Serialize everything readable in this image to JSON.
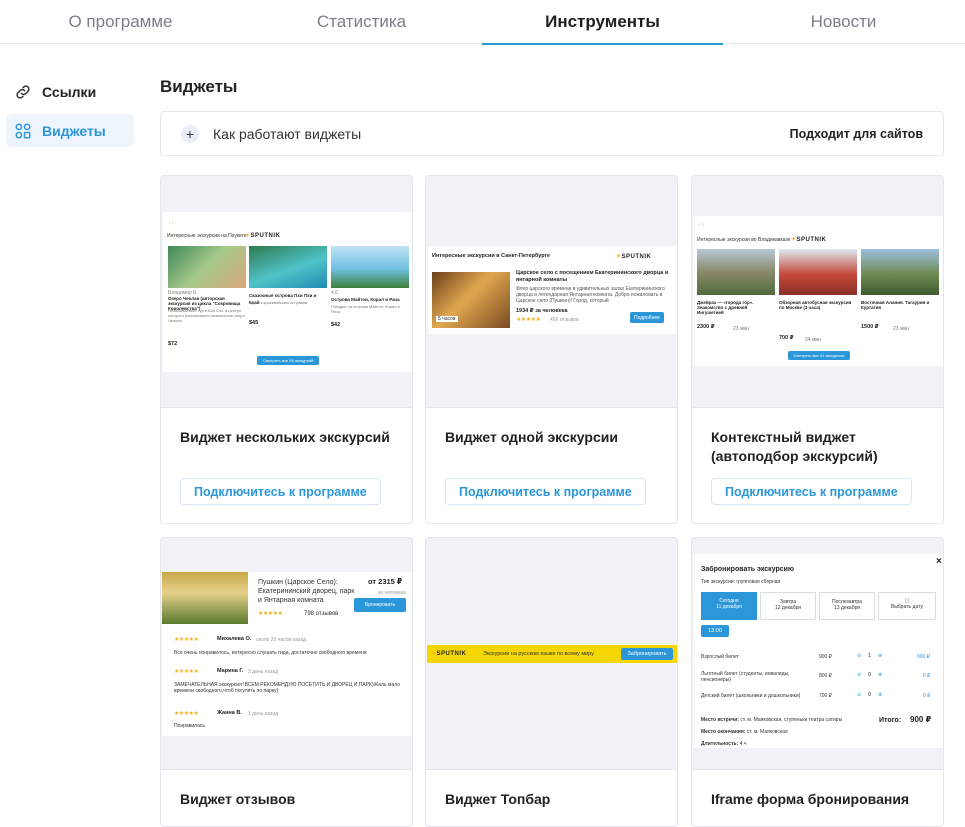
{
  "tabs": [
    {
      "label": "О программе"
    },
    {
      "label": "Статистика"
    },
    {
      "label": "Инструменты"
    },
    {
      "label": "Новости"
    }
  ],
  "sidebar": {
    "items": [
      {
        "label": "Ссылки",
        "icon": "link-icon"
      },
      {
        "label": "Виджеты",
        "icon": "grid-icon"
      }
    ]
  },
  "main": {
    "title": "Виджеты",
    "howto": {
      "label": "Как работают виджеты",
      "right": "Подходит для сайтов",
      "icon": "plus"
    },
    "connect_label": "Подключитесь к программе",
    "cards": [
      {
        "name": "Виджет нескольких экскурсий"
      },
      {
        "name": "Виджет одной экскурсии"
      },
      {
        "name": "Контекстный виджет (автоподбор экскурсий)"
      },
      {
        "name": "Виджет отзывов"
      },
      {
        "name": "Виджет Топбар"
      },
      {
        "name": "Iframe форма бронирования"
      }
    ]
  },
  "previews": {
    "logo": "SPUTNIK",
    "multi": {
      "title": "Интересные экскурсии на Пхукете",
      "items": [
        {
          "author": "Владимир Б.",
          "name": "Озеро Чеолан (авторская экскурсия из цикла \"Сокровища Королевства\")",
          "price": "$72"
        },
        {
          "author": "",
          "name": "Сказочные острова Пхи Пхи и Кхай",
          "price": "$45"
        },
        {
          "author": "4.6",
          "name": "Острова Майтон, Корал и Рача",
          "price": "$42"
        }
      ],
      "button": "Смотреть все 56 экскурсий"
    },
    "single": {
      "header": "Интересные экскурсии в Санкт-Петербурге",
      "name": "Царское село с посещением Екатерининского дворца и янтарной комнаты",
      "desc": "Флер царского времени в удивительных залах Екатерининского дворца и легендарная Янтарная комната. Добро пожаловать в Царское село (Пушкин)! Город, который",
      "price": "1934 ₽ за человека",
      "duration": "5 часов",
      "reviews": "456 отзывов",
      "button": "Подробнее"
    },
    "context": {
      "title": "Интересные экскурсии во Владикавказе",
      "items": [
        {
          "name": "Джейрах — «города гор». Знакомство с древней Ингушетией",
          "price": "2300 ₽",
          "dur": "23 мин"
        },
        {
          "name": "Обзорная автобусная экскурсия по Москве (3 часа)",
          "price": "700 ₽",
          "dur": "24 мин"
        },
        {
          "name": "Восточная Алания. Тагаурия и Куртатия",
          "price": "1500 ₽",
          "dur": "23 мин"
        }
      ],
      "button": "Смотреть все 41 экскурсию"
    },
    "reviews": {
      "tour": "Пушкин (Царское Село): Екатерининский дворец, парк и Янтарная комната",
      "price": "от 2315 ₽",
      "price_note": "за человека",
      "count": "798 отзывов",
      "button": "Бронировать",
      "list": [
        {
          "author": "Михалева О.",
          "time": "около 20 часов назад",
          "text": "Все очень понравилось, интересно слушать гида, достаточно свободного времени"
        },
        {
          "author": "Марина Г.",
          "time": "3 день назад",
          "text": "ЗАМЕЧАТЕЛЬНАЯ экскурсия !ВСЕМ РЕКОМЕНДУЮ ПОСЕТИТЬ И ДВОРЕЦ И ПАРК)Жаль мало времени свободного,чтоб погулять по парку)"
        },
        {
          "author": "Жанна В.",
          "time": "1 день назад",
          "text": "Понравилась"
        }
      ]
    },
    "topbar": {
      "text": "Экскурсии на русском языке по всему миру",
      "button": "Забронировать"
    },
    "booking": {
      "title": "Забронировать экскурсию",
      "type_label": "Тип экскурсии:",
      "type_value": "групповая сборная",
      "dates": [
        {
          "top": "Сегодня",
          "bottom": "11 декабря"
        },
        {
          "top": "Завтра",
          "bottom": "12 декабря"
        },
        {
          "top": "Послезавтра",
          "bottom": "13 декабря"
        },
        {
          "top": "",
          "bottom": "Выбрать дату"
        }
      ],
      "time": "13:00",
      "tickets": [
        {
          "name": "Взрослый билет",
          "price": "900 ₽",
          "qty": "1",
          "sum": "900 ₽"
        },
        {
          "name": "Льготный билет (студенты, инвалиды, пенсионеры)",
          "price": "800 ₽",
          "qty": "0",
          "sum": "0 ₽"
        },
        {
          "name": "Детский билет (школьники и дошкольники)",
          "price": "700 ₽",
          "qty": "0",
          "sum": "0 ₽"
        }
      ],
      "meet_label": "Место встречи:",
      "meet": "ст. м. Маяковская, ступеньки театра сатиры",
      "end_label": "Место окончания:",
      "end": "ст. м. Маяковская",
      "dur_label": "Длительность:",
      "dur": "4 ч",
      "total_label": "Итого:",
      "total": "900 ₽",
      "close": "×"
    }
  },
  "colors": {
    "accent": "#2b97d9",
    "star": "#f3b21c",
    "topbar": "#f5d600"
  }
}
